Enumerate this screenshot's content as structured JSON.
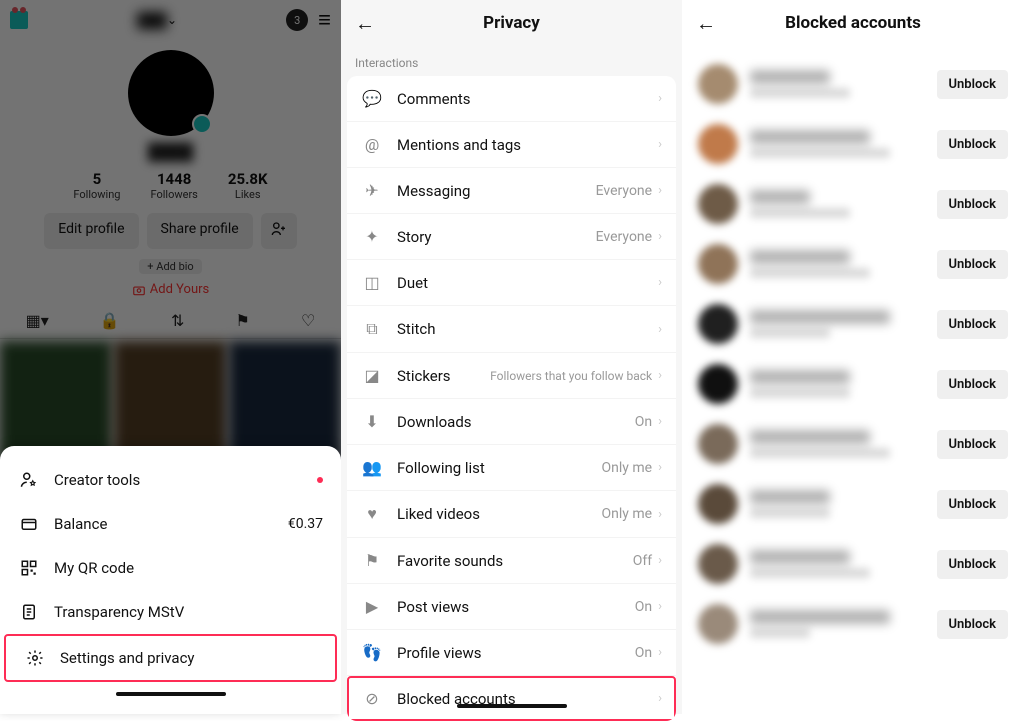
{
  "panel1": {
    "topbar_badge_count": "3",
    "stats": [
      {
        "n": "5",
        "l": "Following"
      },
      {
        "n": "1448",
        "l": "Followers"
      },
      {
        "n": "25.8K",
        "l": "Likes"
      }
    ],
    "edit_profile": "Edit profile",
    "share_profile": "Share profile",
    "add_bio": "+ Add bio",
    "add_yours": "Add Yours",
    "sheet": [
      {
        "label": "Creator tools"
      },
      {
        "label": "Balance",
        "value": "€0.37"
      },
      {
        "label": "My QR code"
      },
      {
        "label": "Transparency MStV"
      },
      {
        "label": "Settings and privacy"
      }
    ]
  },
  "panel2": {
    "title": "Privacy",
    "section": "Interactions",
    "items": [
      {
        "label": "Comments",
        "value": ""
      },
      {
        "label": "Mentions and tags",
        "value": ""
      },
      {
        "label": "Messaging",
        "value": "Everyone"
      },
      {
        "label": "Story",
        "value": "Everyone"
      },
      {
        "label": "Duet",
        "value": ""
      },
      {
        "label": "Stitch",
        "value": ""
      },
      {
        "label": "Stickers",
        "value": "Followers that you follow back"
      },
      {
        "label": "Downloads",
        "value": "On"
      },
      {
        "label": "Following list",
        "value": "Only me"
      },
      {
        "label": "Liked videos",
        "value": "Only me"
      },
      {
        "label": "Favorite sounds",
        "value": "Off"
      },
      {
        "label": "Post views",
        "value": "On"
      },
      {
        "label": "Profile views",
        "value": "On"
      },
      {
        "label": "Blocked accounts",
        "value": ""
      }
    ]
  },
  "panel3": {
    "title": "Blocked accounts",
    "unblock_label": "Unblock",
    "count": 10
  }
}
